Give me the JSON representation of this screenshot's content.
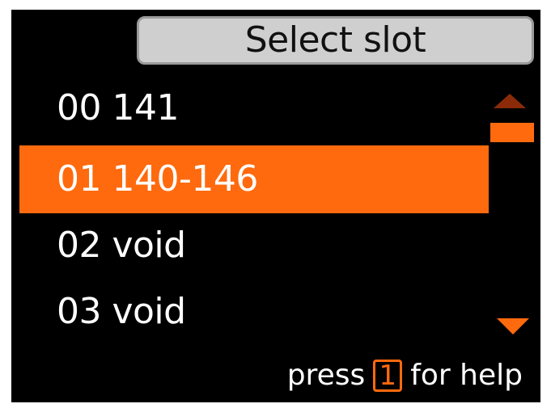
{
  "header": {
    "title": "Select slot"
  },
  "slots": [
    {
      "label": "00 141",
      "selected": false
    },
    {
      "label": "01 140-146",
      "selected": true
    },
    {
      "label": "02 void",
      "selected": false
    },
    {
      "label": "03 void",
      "selected": false
    }
  ],
  "footer": {
    "prefix": "press",
    "key": "1",
    "suffix": "for help"
  },
  "colors": {
    "accent": "#ff6a0e",
    "background": "#000000",
    "title_bg": "#cfcfcf",
    "scroll_up_inactive": "#8a2a08"
  },
  "icons": {
    "scroll_up": "triangle-up-icon",
    "scroll_thumb": "scrollbar-thumb",
    "scroll_down": "triangle-down-icon"
  }
}
